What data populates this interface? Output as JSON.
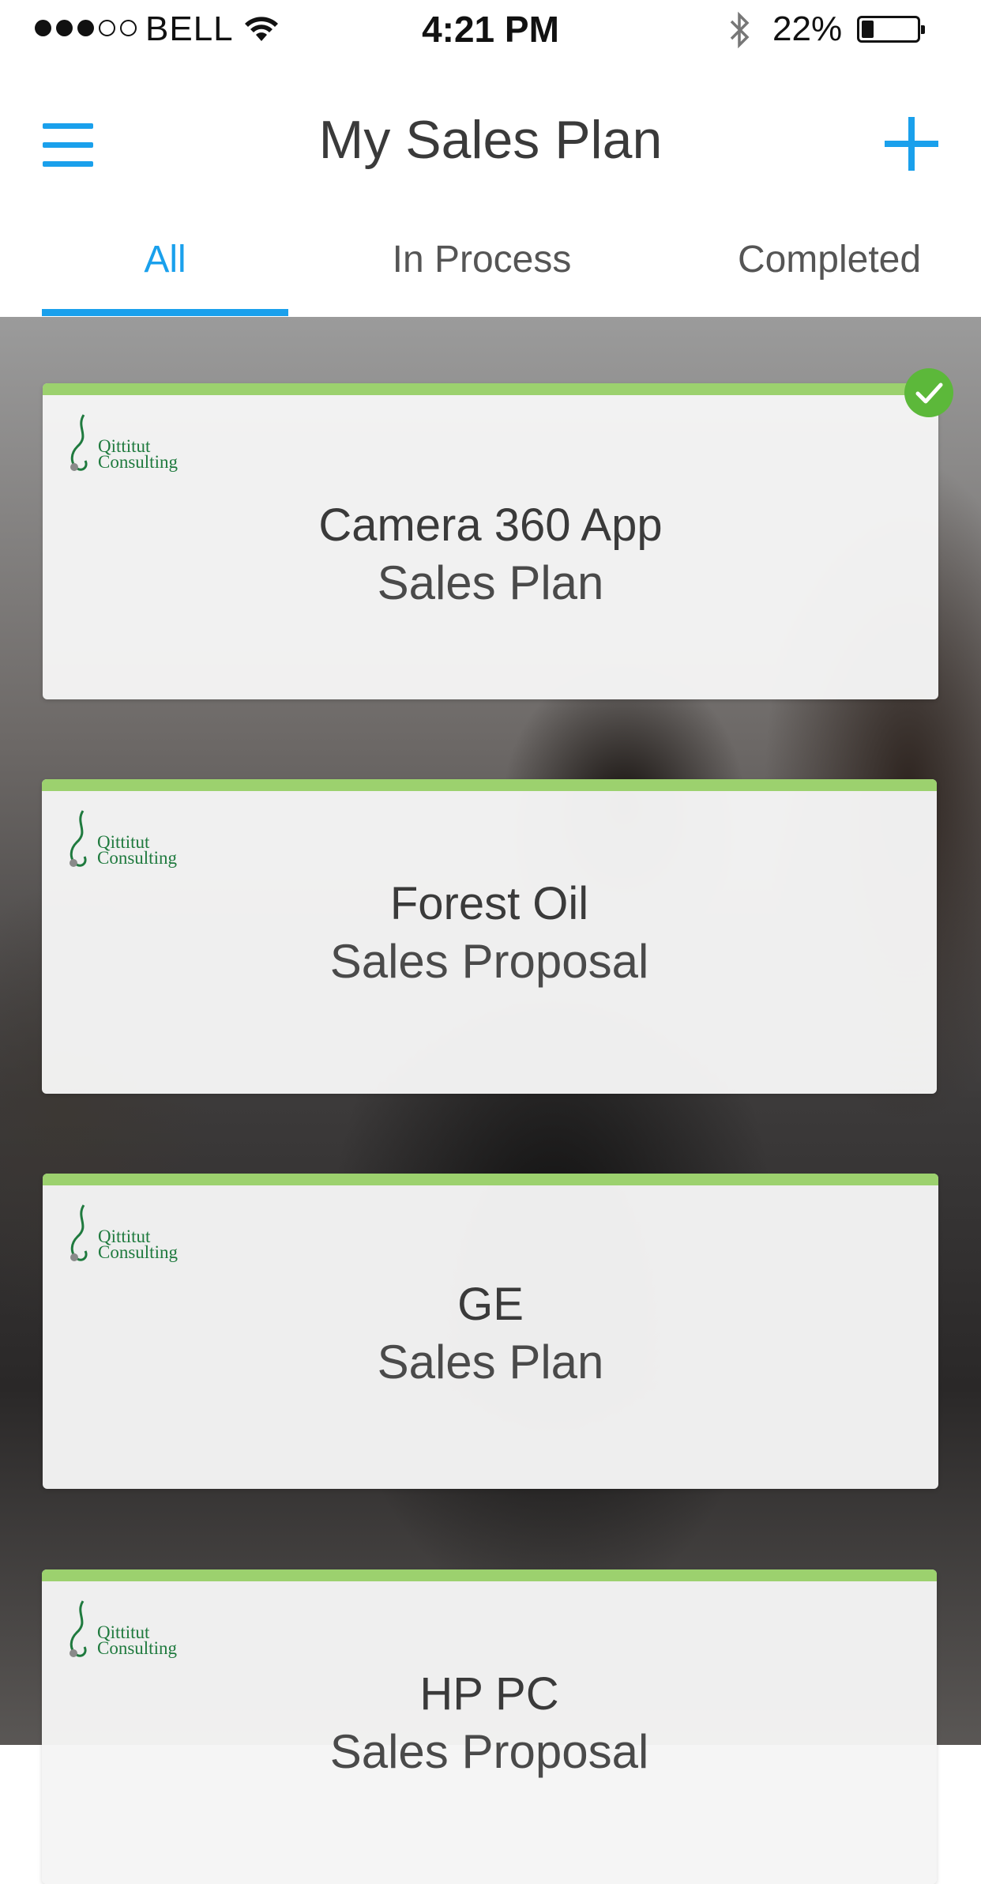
{
  "status_bar": {
    "carrier": "BELL",
    "time": "4:21 PM",
    "battery_percent": "22%",
    "signal_bars_filled": 3,
    "signal_bars_total": 5,
    "battery_level": 0.22
  },
  "nav": {
    "title": "My Sales Plan",
    "menu_icon": "hamburger-menu-icon",
    "add_icon": "plus-icon"
  },
  "tabs": [
    {
      "label": "All",
      "active": true
    },
    {
      "label": "In Process",
      "active": false
    },
    {
      "label": "Completed",
      "active": false
    }
  ],
  "cards": [
    {
      "company": "Camera 360 App",
      "type": "Sales Plan",
      "completed": true,
      "logo_text_line1": "Qittitut",
      "logo_text_line2": "Consulting"
    },
    {
      "company": "Forest Oil",
      "type": "Sales Proposal",
      "completed": false,
      "logo_text_line1": "Qittitut",
      "logo_text_line2": "Consulting"
    },
    {
      "company": "GE",
      "type": "Sales Plan",
      "completed": false,
      "logo_text_line1": "Qittitut",
      "logo_text_line2": "Consulting"
    },
    {
      "company": "HP PC",
      "type": "Sales Proposal",
      "completed": false,
      "logo_text_line1": "Qittitut",
      "logo_text_line2": "Consulting"
    }
  ],
  "colors": {
    "accent": "#1aa0ec",
    "card_top_bar": "#9cd16e",
    "completed_badge": "#5cb83a",
    "logo_text": "#1f7a3e"
  }
}
